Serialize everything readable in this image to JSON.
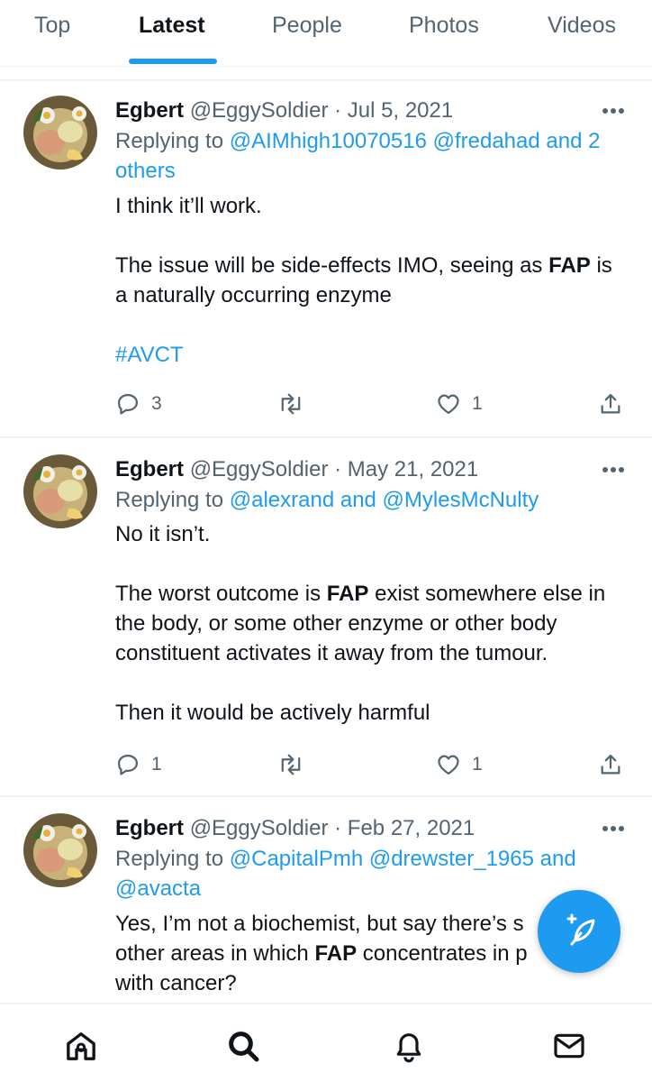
{
  "tabs": [
    {
      "label": "Top",
      "active": false
    },
    {
      "label": "Latest",
      "active": true
    },
    {
      "label": "People",
      "active": false
    },
    {
      "label": "Photos",
      "active": false
    },
    {
      "label": "Videos",
      "active": false
    }
  ],
  "tweets": [
    {
      "name": "Egbert",
      "meta": "@EggySoldier · Jul 5, 2021",
      "reply_prefix": "Replying to ",
      "reply_mentions": "@AIMhigh10070516 @fredahad and 2 others",
      "body": {
        "p1": "I think it’ll work.",
        "p2_a": "The issue will be side-effects IMO, seeing as ",
        "p2_b": "FAP",
        "p2_c": " is a naturally occurring enzyme",
        "hashtag": "#AVCT"
      },
      "replies": "3",
      "likes": "1"
    },
    {
      "name": "Egbert",
      "meta": "@EggySoldier · May 21, 2021",
      "reply_prefix": "Replying to ",
      "reply_mentions": "@alexrand and @MylesMcNulty",
      "body": {
        "p1": "No it isn’t.",
        "p2_a": "The worst outcome is ",
        "p2_b": "FAP",
        "p2_c": " exist somewhere else in the body, or some other enzyme or other body constituent activates it away from the tumour.",
        "p3": "Then it would be actively harmful"
      },
      "replies": "1",
      "likes": "1"
    },
    {
      "name": "Egbert",
      "meta": "@EggySoldier · Feb 27, 2021",
      "reply_prefix": "Replying to ",
      "reply_mentions": "@CapitalPmh @drewster_1965 and @avacta",
      "body": {
        "p1_a": "Yes, I’m not a biochemist, but say there’s s",
        "p1_b": "other areas in which ",
        "p1_c": "FAP",
        "p1_d": " concentrates in p",
        "p1_e": "with cancer?"
      }
    }
  ],
  "icons": {
    "reply": "reply-icon",
    "retweet": "retweet-icon",
    "like": "heart-icon",
    "share": "share-icon",
    "more": "more-icon",
    "compose": "compose-icon",
    "home": "home-icon",
    "search": "search-icon",
    "notifications": "bell-icon",
    "messages": "mail-icon"
  },
  "colors": {
    "accent": "#1d9bf0",
    "text": "#0f1419",
    "secondary": "#536471"
  }
}
